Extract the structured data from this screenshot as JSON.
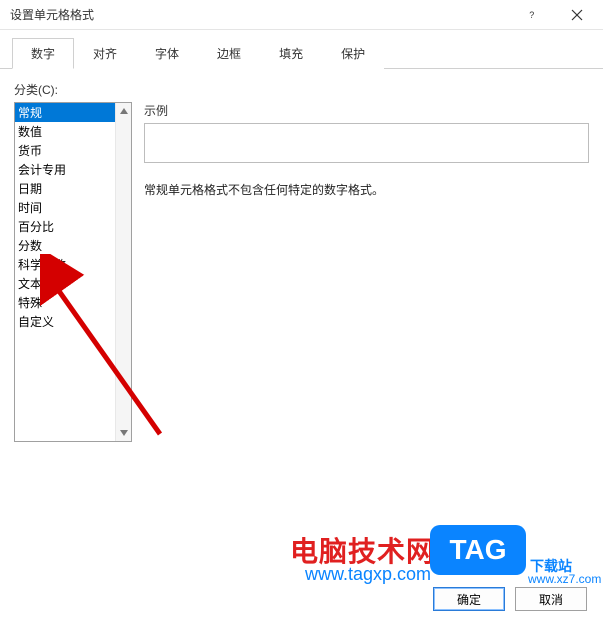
{
  "window": {
    "title": "设置单元格格式"
  },
  "tabs": {
    "items": [
      "数字",
      "对齐",
      "字体",
      "边框",
      "填充",
      "保护"
    ],
    "active_index": 0
  },
  "category": {
    "label": "分类(C):",
    "items": [
      "常规",
      "数值",
      "货币",
      "会计专用",
      "日期",
      "时间",
      "百分比",
      "分数",
      "科学记数",
      "文本",
      "特殊",
      "自定义"
    ],
    "selected_index": 0
  },
  "sample": {
    "label": "示例",
    "value": ""
  },
  "description": "常规单元格格式不包含任何特定的数字格式。",
  "footer": {
    "ok": "确定",
    "cancel": "取消"
  },
  "watermark": {
    "site_name": "电脑技术网",
    "tag": "TAG",
    "sub": "下载站",
    "sub_url": "www.xz7.com",
    "url": "www.tagxp.com"
  }
}
